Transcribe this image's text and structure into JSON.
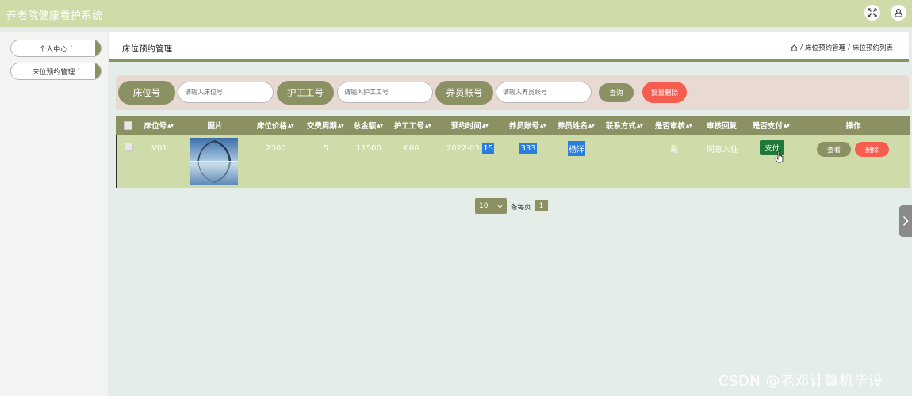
{
  "header": {
    "app_title": "养老院健康看护系统",
    "icons": [
      "fullscreen-icon",
      "user-icon"
    ]
  },
  "sidebar": {
    "items": [
      {
        "label": "个人中心",
        "caret": "˅"
      },
      {
        "label": "床位预约管理",
        "caret": "˅"
      }
    ]
  },
  "page": {
    "title": "床位预约管理",
    "breadcrumb": {
      "sep": "/",
      "level1": "床位预约管理",
      "level2": "床位预约列表"
    }
  },
  "search": {
    "bed_label": "床位号",
    "bed_placeholder": "请输入床位号",
    "nurse_label": "护工工号",
    "nurse_placeholder": "请输入护工工号",
    "member_label": "养员账号",
    "member_placeholder": "请输入养员账号",
    "query_button": "查询",
    "batch_delete_button": "批量删除"
  },
  "table": {
    "sort_glyph": "▲▼",
    "columns": {
      "bed_no": "床位号",
      "image": "图片",
      "bed_price": "床位价格",
      "period": "交费周期",
      "total": "总金额",
      "nurse_no": "护工工号",
      "reserve_time": "预约时间",
      "member_account": "养员账号",
      "member_name": "养员姓名",
      "contact": "联系方式",
      "audited": "是否审核",
      "audit_reply": "审核回复",
      "paid": "是否支付",
      "actions": "操作"
    },
    "rows": [
      {
        "bed_no": "V01",
        "bed_price": "2300",
        "period": "5",
        "total": "11500",
        "nurse_no": "666",
        "reserve_time_plain": "2022-03-",
        "reserve_time_hl": "15",
        "member_account": "333",
        "member_name": "杨洋",
        "contact": "",
        "audited": "是",
        "audit_reply": "同意入住",
        "pay_button": "支付",
        "view_button": "查看",
        "delete_button": "删除"
      }
    ]
  },
  "pagination": {
    "page_size": "10",
    "per_page_text": "条每页",
    "current_page": "1"
  },
  "watermark": "CSDN @老邓计算机毕设",
  "colors": {
    "header_bg": "#cfdcaa",
    "accent": "#8b9163",
    "danger": "#f75d4f",
    "pay_green": "#1e7a36",
    "highlight": "#2a7ee0",
    "search_bg": "#e8d9d3"
  }
}
